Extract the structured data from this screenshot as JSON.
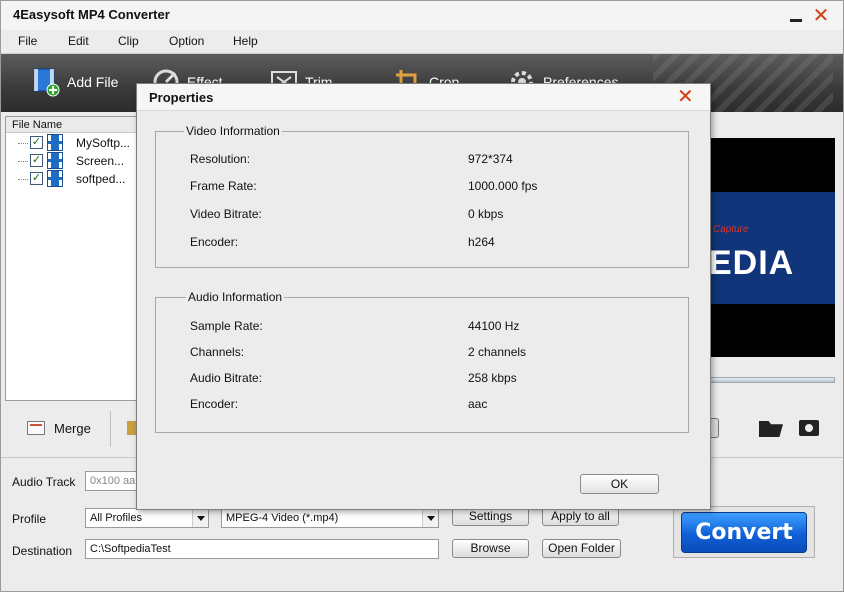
{
  "app": {
    "title": "4Easysoft MP4 Converter"
  },
  "menu": {
    "items": [
      "File",
      "Edit",
      "Clip",
      "Option",
      "Help"
    ]
  },
  "toolbar": {
    "add_file": "Add File",
    "effect": "Effect",
    "trim": "Trim",
    "crop": "Crop",
    "preferences": "Preferences"
  },
  "file_list": {
    "header": "File Name",
    "files": [
      {
        "name": "MySoftp...",
        "checked": true
      },
      {
        "name": "Screen...",
        "checked": true
      },
      {
        "name": "softped...",
        "checked": true
      }
    ]
  },
  "preview": {
    "capture_text": "Capture",
    "banner_text": "EDIA",
    "watermark": "SOFTPEDIA"
  },
  "merge": {
    "label": "Merge"
  },
  "bottom": {
    "audio_track_label": "Audio Track",
    "audio_track_value": "0x100 aa",
    "profile_label": "Profile",
    "profile_category": "All Profiles",
    "profile_format": "MPEG-4 Video (*.mp4)",
    "settings_button": "Settings",
    "apply_all_button": "Apply to all",
    "destination_label": "Destination",
    "destination_value": "C:\\SoftpediaTest",
    "browse_button": "Browse",
    "open_folder_button": "Open Folder",
    "convert_button": "Convert"
  },
  "dialog": {
    "title": "Properties",
    "video_group": "Video Information",
    "video": [
      {
        "label": "Resolution:",
        "value": "972*374"
      },
      {
        "label": "Frame Rate:",
        "value": "1000.000 fps"
      },
      {
        "label": "Video Bitrate:",
        "value": "0 kbps"
      },
      {
        "label": "Encoder:",
        "value": "h264"
      }
    ],
    "audio_group": "Audio Information",
    "audio": [
      {
        "label": "Sample Rate:",
        "value": "44100 Hz"
      },
      {
        "label": "Channels:",
        "value": "2 channels"
      },
      {
        "label": "Audio Bitrate:",
        "value": "258 kbps"
      },
      {
        "label": "Encoder:",
        "value": "aac"
      }
    ],
    "ok_button": "OK"
  },
  "colors": {
    "convert_button": "#1060d8",
    "close_icon": "#d04010",
    "toolbar_bg": "#3a3a3a"
  }
}
